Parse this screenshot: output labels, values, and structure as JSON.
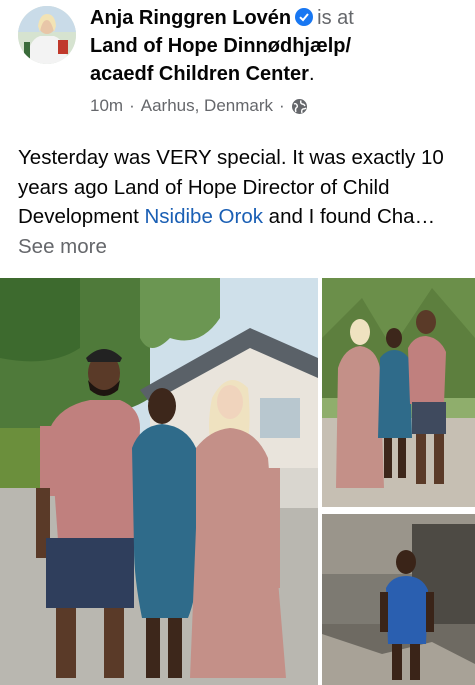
{
  "post": {
    "author": "Anja Ringgren Lovén",
    "is_at": "is at",
    "location_line1": "Land of Hope Dinnødhjælp/",
    "location_line2": "acaedf Children Center",
    "location_end": ".",
    "time": "10m",
    "place": "Aarhus, Denmark",
    "separator": "·",
    "audience_icon": "globe-icon",
    "text_part1": "Yesterday was VERY special. It was exactly 10 years ago Land of Hope Director of Child Development ",
    "mention": "Nsidibe Orok",
    "text_part2": " and I found Cha… ",
    "see_more": "See more"
  },
  "colors": {
    "verified": "#1877f2",
    "mention": "#1a5fb4",
    "secondary_text": "#65676b"
  }
}
